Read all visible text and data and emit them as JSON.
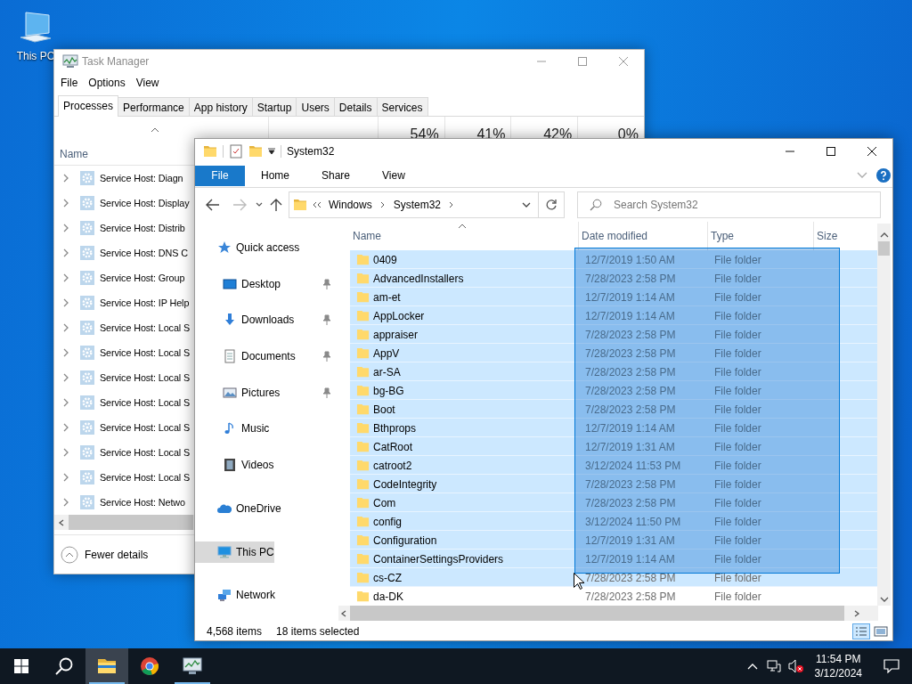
{
  "desktop_icons": [
    {
      "label": "This PC"
    }
  ],
  "task_manager": {
    "title": "Task Manager",
    "menu": [
      "File",
      "Options",
      "View"
    ],
    "tabs": [
      {
        "label": "Processes",
        "selected": true
      },
      {
        "label": "Performance",
        "selected": false
      },
      {
        "label": "App history",
        "selected": false
      },
      {
        "label": "Startup",
        "selected": false
      },
      {
        "label": "Users",
        "selected": false
      },
      {
        "label": "Details",
        "selected": false
      },
      {
        "label": "Services",
        "selected": false
      }
    ],
    "name_column": "Name",
    "usage": [
      "54%",
      "41%",
      "42%",
      "0%"
    ],
    "processes": [
      {
        "name": "Service Host: Diagn",
        "expanded": false
      },
      {
        "name": "Service Host: Display",
        "expanded": false
      },
      {
        "name": "Service Host: Distrib",
        "expanded": false
      },
      {
        "name": "Service Host: DNS C",
        "expanded": false
      },
      {
        "name": "Service Host: Group",
        "expanded": false
      },
      {
        "name": "Service Host: IP Help",
        "expanded": false
      },
      {
        "name": "Service Host: Local S",
        "expanded": false
      },
      {
        "name": "Service Host: Local S",
        "expanded": false
      },
      {
        "name": "Service Host: Local S",
        "expanded": false
      },
      {
        "name": "Service Host: Local S",
        "expanded": false
      },
      {
        "name": "Service Host: Local S",
        "expanded": false
      },
      {
        "name": "Service Host: Local S",
        "expanded": false
      },
      {
        "name": "Service Host: Local S",
        "expanded": false
      },
      {
        "name": "Service Host: Netwo",
        "expanded": false
      }
    ],
    "footer": "Fewer details"
  },
  "explorer": {
    "title": "System32",
    "ribbon_tabs": [
      {
        "label": "File",
        "kind": "file"
      },
      {
        "label": "Home",
        "kind": "tab"
      },
      {
        "label": "Share",
        "kind": "tab"
      },
      {
        "label": "View",
        "kind": "tab"
      }
    ],
    "breadcrumbs": [
      "Windows",
      "System32"
    ],
    "search": {
      "placeholder": "Search System32"
    },
    "navigation": [
      {
        "label": "Quick access",
        "kind": "star",
        "selected": false,
        "children": [
          {
            "label": "Desktop",
            "kind": "desktop",
            "pinned": true,
            "selected": false
          },
          {
            "label": "Downloads",
            "kind": "download",
            "pinned": true,
            "selected": false
          },
          {
            "label": "Documents",
            "kind": "document",
            "pinned": true,
            "selected": false
          },
          {
            "label": "Pictures",
            "kind": "picture",
            "pinned": true,
            "selected": false
          },
          {
            "label": "Music",
            "kind": "music",
            "pinned": false,
            "selected": false
          },
          {
            "label": "Videos",
            "kind": "video",
            "pinned": false,
            "selected": false
          }
        ]
      },
      {
        "label": "OneDrive",
        "kind": "cloud",
        "selected": false
      },
      {
        "label": "This PC",
        "kind": "computer",
        "selected": true
      },
      {
        "label": "Network",
        "kind": "network",
        "selected": false
      }
    ],
    "columns": [
      "Name",
      "Date modified",
      "Type",
      "Size"
    ],
    "files": [
      {
        "name": "0409",
        "date": "12/7/2019 1:50 AM",
        "type": "File folder",
        "selected": true
      },
      {
        "name": "AdvancedInstallers",
        "date": "7/28/2023 2:58 PM",
        "type": "File folder",
        "selected": true
      },
      {
        "name": "am-et",
        "date": "12/7/2019 1:14 AM",
        "type": "File folder",
        "selected": true
      },
      {
        "name": "AppLocker",
        "date": "12/7/2019 1:14 AM",
        "type": "File folder",
        "selected": true
      },
      {
        "name": "appraiser",
        "date": "7/28/2023 2:58 PM",
        "type": "File folder",
        "selected": true
      },
      {
        "name": "AppV",
        "date": "7/28/2023 2:58 PM",
        "type": "File folder",
        "selected": true
      },
      {
        "name": "ar-SA",
        "date": "7/28/2023 2:58 PM",
        "type": "File folder",
        "selected": true
      },
      {
        "name": "bg-BG",
        "date": "7/28/2023 2:58 PM",
        "type": "File folder",
        "selected": true
      },
      {
        "name": "Boot",
        "date": "7/28/2023 2:58 PM",
        "type": "File folder",
        "selected": true
      },
      {
        "name": "Bthprops",
        "date": "12/7/2019 1:14 AM",
        "type": "File folder",
        "selected": true
      },
      {
        "name": "CatRoot",
        "date": "12/7/2019 1:31 AM",
        "type": "File folder",
        "selected": true
      },
      {
        "name": "catroot2",
        "date": "3/12/2024 11:53 PM",
        "type": "File folder",
        "selected": true
      },
      {
        "name": "CodeIntegrity",
        "date": "7/28/2023 2:58 PM",
        "type": "File folder",
        "selected": true
      },
      {
        "name": "Com",
        "date": "7/28/2023 2:58 PM",
        "type": "File folder",
        "selected": true
      },
      {
        "name": "config",
        "date": "3/12/2024 11:50 PM",
        "type": "File folder",
        "selected": true
      },
      {
        "name": "Configuration",
        "date": "12/7/2019 1:31 AM",
        "type": "File folder",
        "selected": true
      },
      {
        "name": "ContainerSettingsProviders",
        "date": "12/7/2019 1:14 AM",
        "type": "File folder",
        "selected": true
      },
      {
        "name": "cs-CZ",
        "date": "7/28/2023 2:58 PM",
        "type": "File folder",
        "selected": true
      },
      {
        "name": "da-DK",
        "date": "7/28/2023 2:58 PM",
        "type": "File folder",
        "selected": false
      }
    ],
    "status": {
      "count": "4,568 items",
      "selection": "18 items selected"
    }
  },
  "taskbar": {
    "apps": [
      {
        "kind": "file-explorer",
        "active": true,
        "running": true
      },
      {
        "kind": "browser",
        "active": false,
        "running": false
      },
      {
        "kind": "task-manager",
        "active": false,
        "running": true
      }
    ],
    "time": "11:54 PM",
    "date": "3/12/2024"
  }
}
